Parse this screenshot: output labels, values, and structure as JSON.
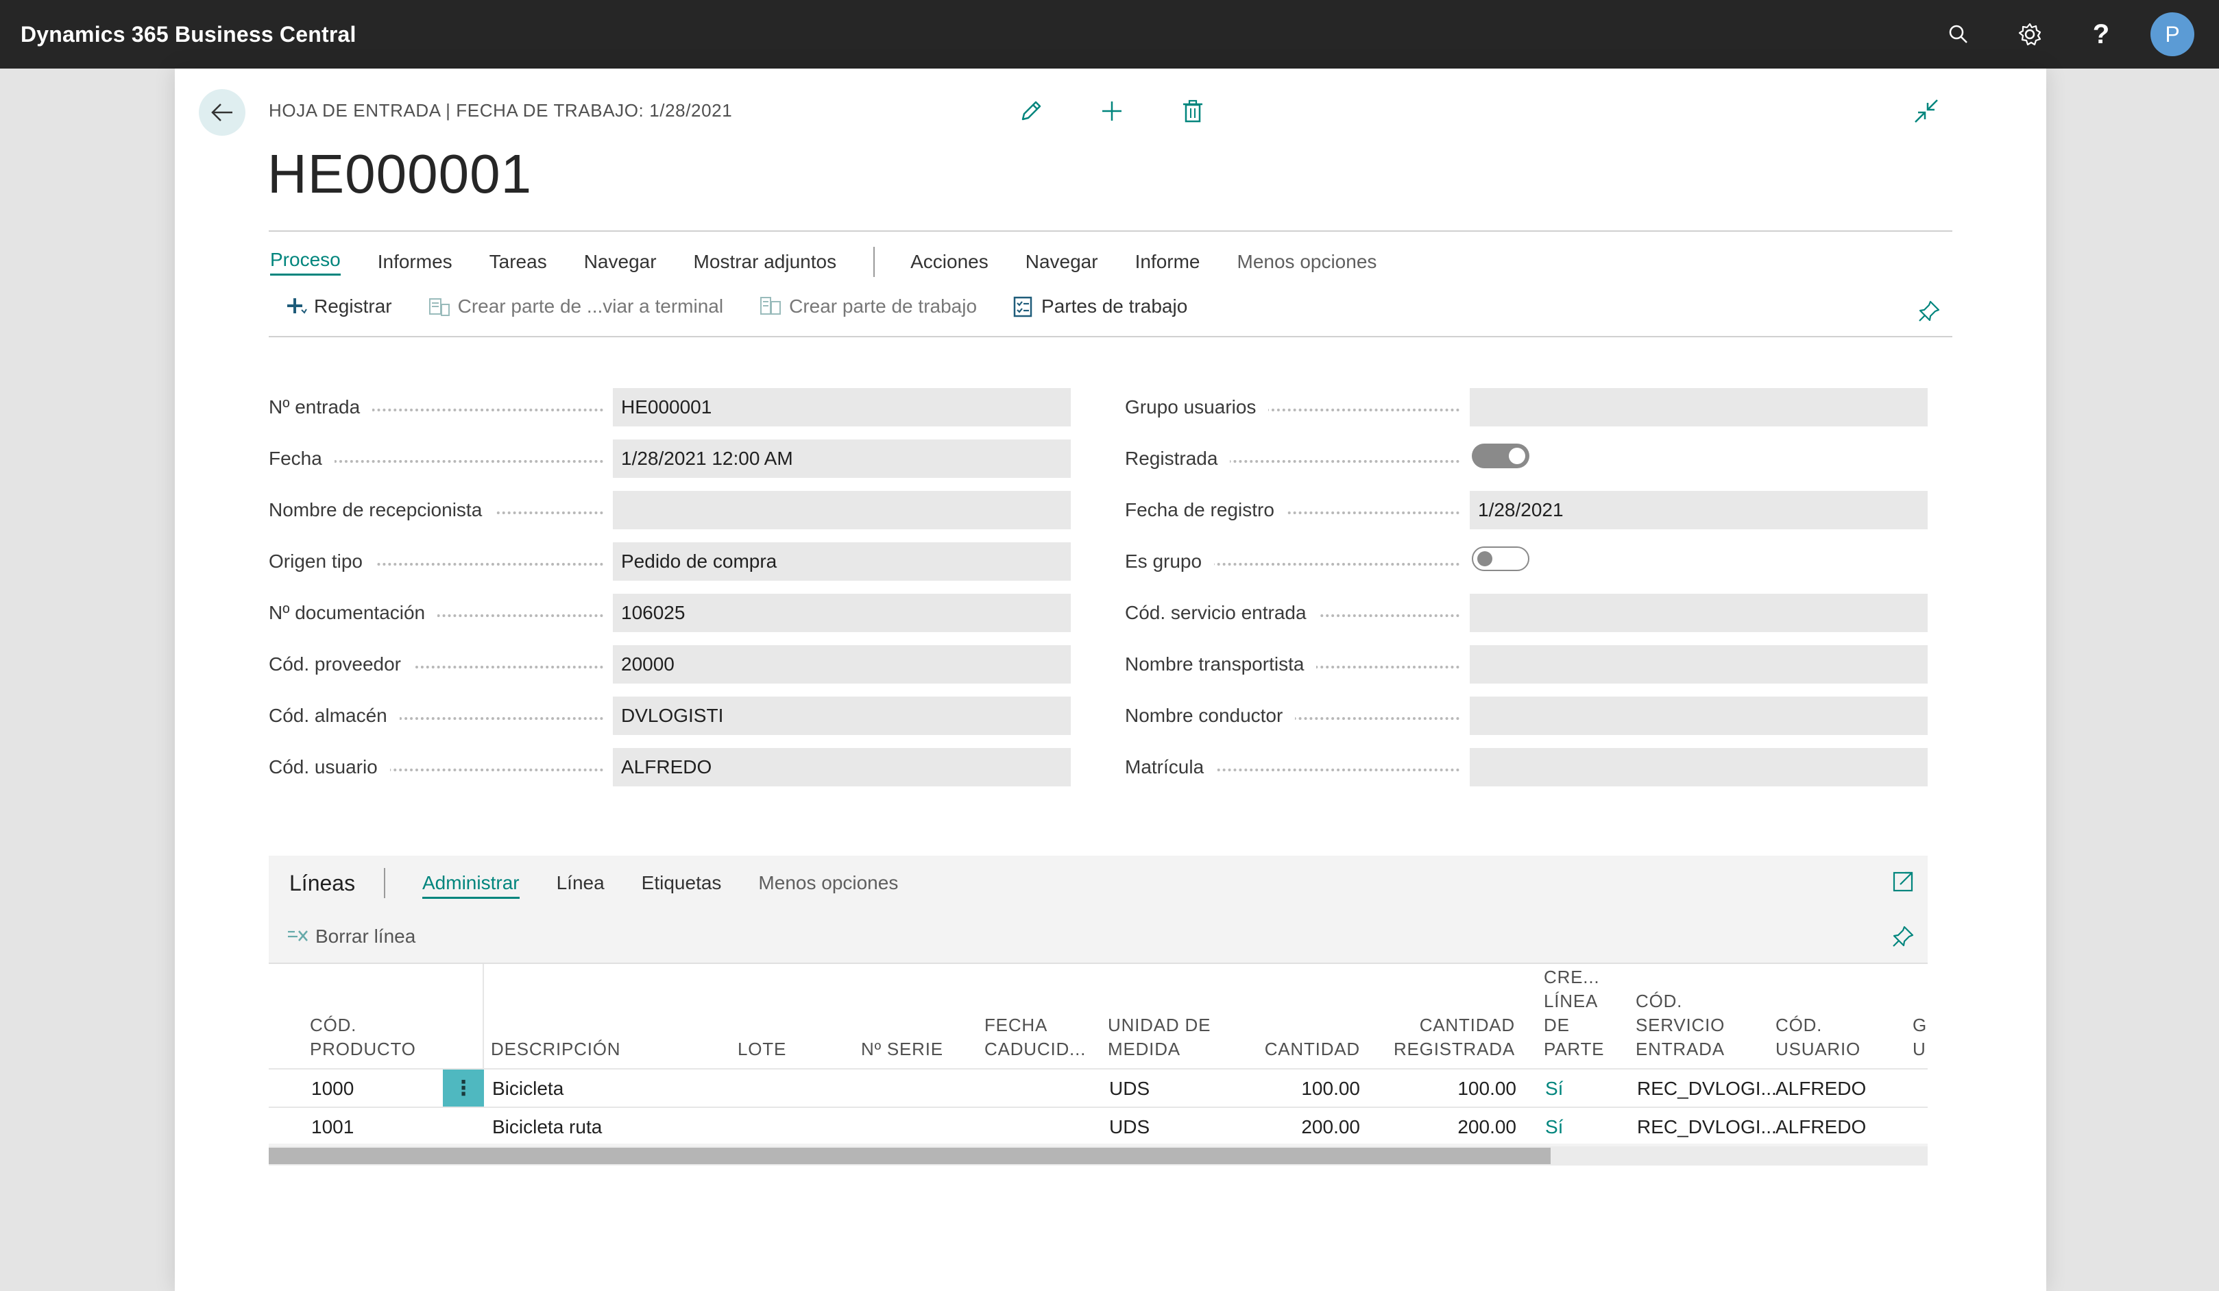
{
  "app": {
    "title": "Dynamics 365 Business Central",
    "avatar_initial": "P",
    "help_symbol": "?"
  },
  "header": {
    "breadcrumb": "HOJA DE ENTRADA | FECHA DE TRABAJO: 1/28/2021",
    "title": "HE000001"
  },
  "menu": {
    "proceso": "Proceso",
    "informes": "Informes",
    "tareas": "Tareas",
    "navegar": "Navegar",
    "mostrar_adjuntos": "Mostrar adjuntos",
    "acciones": "Acciones",
    "navegar2": "Navegar",
    "informe": "Informe",
    "menos_opciones": "Menos opciones"
  },
  "actions": {
    "registrar": "Registrar",
    "crear_parte_terminal": "Crear parte de ...viar a terminal",
    "crear_parte_trabajo": "Crear parte de trabajo",
    "partes_trabajo": "Partes de trabajo"
  },
  "form_left": [
    {
      "label": "Nº entrada",
      "value": "HE000001"
    },
    {
      "label": "Fecha",
      "value": "1/28/2021 12:00 AM"
    },
    {
      "label": "Nombre de recepcionista",
      "value": ""
    },
    {
      "label": "Origen tipo",
      "value": "Pedido de compra"
    },
    {
      "label": "Nº documentación",
      "value": "106025"
    },
    {
      "label": "Cód. proveedor",
      "value": "20000"
    },
    {
      "label": "Cód. almacén",
      "value": "DVLOGISTI"
    },
    {
      "label": "Cód. usuario",
      "value": "ALFREDO"
    }
  ],
  "form_right": [
    {
      "label": "Grupo usuarios",
      "value": ""
    },
    {
      "label": "Registrada",
      "toggle": true
    },
    {
      "label": "Fecha de registro",
      "value": "1/28/2021"
    },
    {
      "label": "Es grupo",
      "toggle": false
    },
    {
      "label": "Cód. servicio entrada",
      "value": ""
    },
    {
      "label": "Nombre transportista",
      "value": ""
    },
    {
      "label": "Nombre conductor",
      "value": ""
    },
    {
      "label": "Matrícula",
      "value": ""
    }
  ],
  "lines": {
    "title": "Líneas",
    "menu_administrar": "Administrar",
    "menu_linea": "Línea",
    "menu_etiquetas": "Etiquetas",
    "menu_menos": "Menos opciones",
    "borrar_linea": "Borrar línea",
    "columns": {
      "cod_producto": [
        "CÓD.",
        "PRODUCTO"
      ],
      "descripcion": "DESCRIPCIÓN",
      "lote": "LOTE",
      "n_serie": "Nº SERIE",
      "fecha_caducidad": [
        "FECHA",
        "CADUCID..."
      ],
      "unidad_medida": [
        "UNIDAD DE",
        "MEDIDA"
      ],
      "cantidad": "CANTIDAD",
      "cantidad_registrada": [
        "CANTIDAD",
        "REGISTRADA"
      ],
      "crea_linea_parte": [
        "CRE...",
        "LÍNEA",
        "DE",
        "PARTE"
      ],
      "cod_servicio_entrada": [
        "CÓD.",
        "SERVICIO",
        "ENTRADA"
      ],
      "cod_usuario": [
        "CÓD.",
        "USUARIO"
      ],
      "truncated": [
        "G",
        "U"
      ]
    },
    "rows": [
      {
        "cod": "1000",
        "desc": "Bicicleta",
        "um": "UDS",
        "cantidad": "100.00",
        "cant_reg": "100.00",
        "crea": "Sí",
        "serv": "REC_DVLOGI...",
        "usuario": "ALFREDO"
      },
      {
        "cod": "1001",
        "desc": "Bicicleta ruta",
        "um": "UDS",
        "cantidad": "200.00",
        "cant_reg": "200.00",
        "crea": "Sí",
        "serv": "REC_DVLOGI...",
        "usuario": "ALFREDO"
      }
    ],
    "row_menu_glyph": "⋮"
  },
  "colors": {
    "accent": "#00857d",
    "appbar": "#262626",
    "avatar": "#5b9bd5"
  }
}
